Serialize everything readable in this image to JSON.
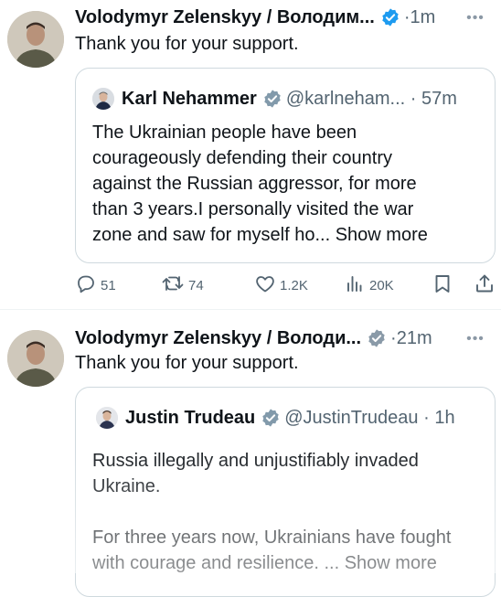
{
  "tweets": [
    {
      "author_name": "Volodymyr Zelenskyy / Володим...",
      "time": "·1m",
      "text": "Thank you for your support.",
      "quote": {
        "author_name": "Karl Nehammer",
        "handle_time": "@karlneham... · 57m",
        "lines": [
          "The Ukrainian people have been",
          "courageously defending their country",
          "against the Russian aggressor, for more",
          "than 3 years.I personally visited the war",
          "zone and saw for myself ho..."
        ],
        "show_more": "Show more"
      },
      "actions": {
        "replies": "51",
        "reposts": "74",
        "likes": "1.2K",
        "views": "20K"
      }
    },
    {
      "author_name": "Volodymyr Zelenskyy / Володи...",
      "time": "·21m",
      "text": "Thank you for your support.",
      "quote": {
        "author_name": "Justin Trudeau",
        "handle_time": "@JustinTrudeau · 1h",
        "lines": [
          "Russia illegally and unjustifiably invaded",
          "Ukraine.",
          "",
          "For three years now, Ukrainians have fought",
          "with courage and resilience. ..."
        ],
        "show_more": "Show more"
      }
    }
  ],
  "colors": {
    "verified": "#1d9bf0",
    "muted": "#536471",
    "border": "#cfd9de"
  },
  "icons": [
    "more-icon",
    "verified-icon",
    "reply-icon",
    "repost-icon",
    "like-icon",
    "views-icon",
    "bookmark-icon",
    "share-icon"
  ]
}
